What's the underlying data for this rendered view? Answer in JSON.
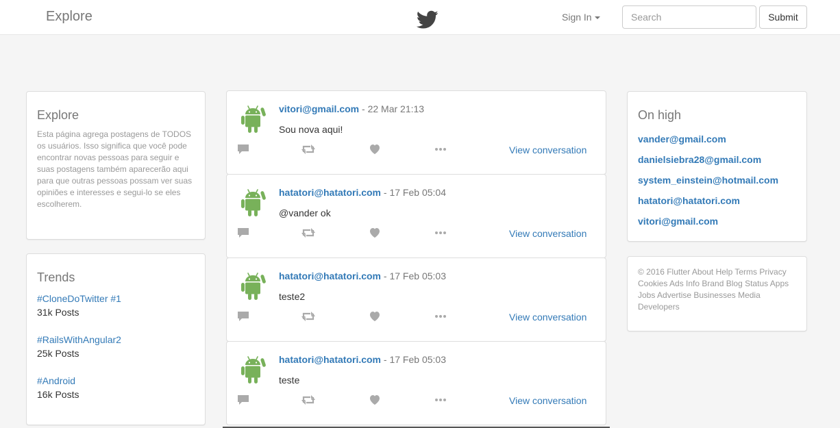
{
  "navbar": {
    "brand": "Explore",
    "logo_icon": "twitter-bird-icon",
    "signin_label": "Sign In",
    "search_placeholder": "Search",
    "submit_label": "Submit"
  },
  "explore": {
    "title": "Explore",
    "description": "Esta página agrega postagens de TODOS os usuários. Isso significa que você pode encontrar novas pessoas para seguir e suas postagens também aparecerão aqui para que outras pessoas possam ver suas opiniões e interesses e segui-lo se eles escolherem."
  },
  "trends": {
    "title": "Trends",
    "items": [
      {
        "tag": "#CloneDoTwitter #1",
        "count": "31k Posts"
      },
      {
        "tag": "#RailsWithAngular2",
        "count": "25k Posts"
      },
      {
        "tag": "#Android",
        "count": "16k Posts"
      }
    ]
  },
  "tweets": [
    {
      "author": "vitori@gmail.com",
      "sep": "-",
      "time": "22 Mar 21:13",
      "text": "Sou nova aqui!",
      "view_label": "View conversation"
    },
    {
      "author": "hatatori@hatatori.com",
      "sep": "-",
      "time": "17 Feb 05:04",
      "text": "@vander ok",
      "view_label": "View conversation"
    },
    {
      "author": "hatatori@hatatori.com",
      "sep": "-",
      "time": "17 Feb 05:03",
      "text": "teste2",
      "view_label": "View conversation"
    },
    {
      "author": "hatatori@hatatori.com",
      "sep": "-",
      "time": "17 Feb 05:03",
      "text": "teste",
      "view_label": "View conversation"
    }
  ],
  "on_high": {
    "title": "On high",
    "users": [
      "vander@gmail.com",
      "danielsiebra28@gmail.com",
      "system_einstein@hotmail.com",
      "hatatori@hatatori.com",
      "vitori@gmail.com"
    ]
  },
  "footer": {
    "text": "© 2016 Flutter About Help Terms Privacy Cookies Ads Info Brand Blog Status Apps Jobs Advertise Businesses Media Developers"
  },
  "colors": {
    "link": "#337ab7",
    "muted": "#999999",
    "android_green": "#78b15a",
    "twitter_icon": "#444444",
    "action_icon": "#aaaaaa"
  }
}
